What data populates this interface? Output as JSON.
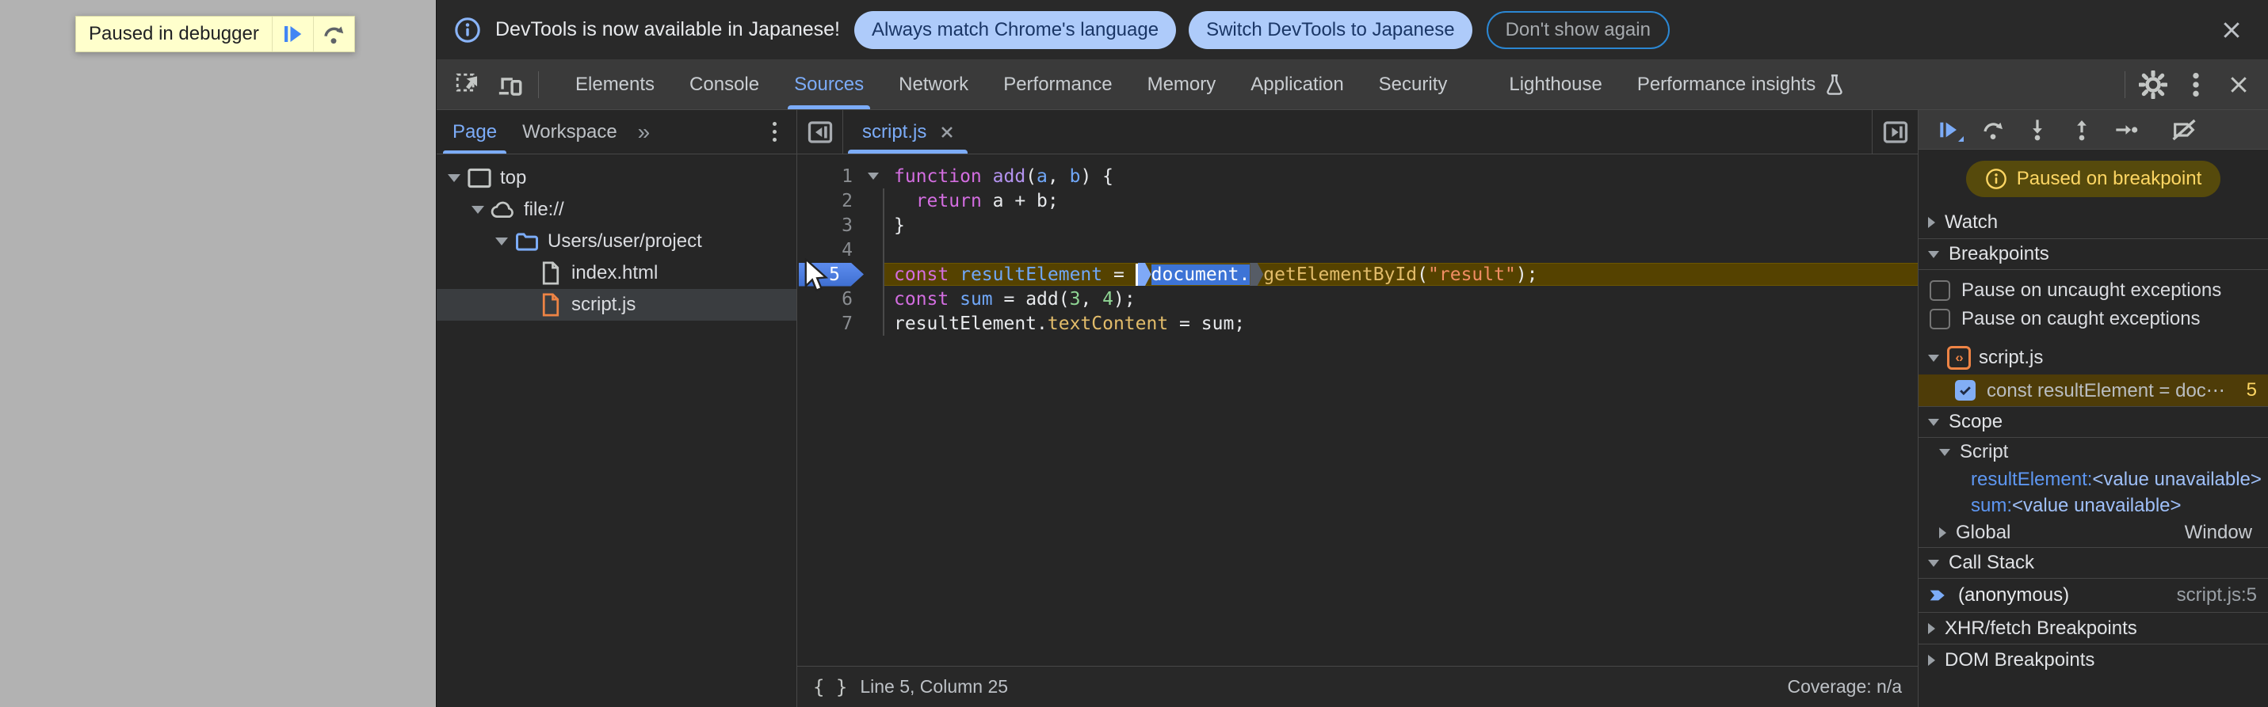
{
  "page_overlay": {
    "paused_label": "Paused in debugger"
  },
  "infobar": {
    "message": "DevTools is now available in Japanese!",
    "actions": [
      "Always match Chrome's language",
      "Switch DevTools to Japanese"
    ],
    "dismiss_label": "Don't show again"
  },
  "toolbar": {
    "tabs": [
      "Elements",
      "Console",
      "Sources",
      "Network",
      "Performance",
      "Memory",
      "Application",
      "Security",
      "Lighthouse",
      "Performance insights"
    ],
    "selected_tab": "Sources",
    "experimental_tab": "Performance insights"
  },
  "navigator": {
    "tabs": [
      "Page",
      "Workspace"
    ],
    "selected_tab": "Page",
    "more_tabs_symbol": "»",
    "tree": [
      {
        "label": "top",
        "icon": "frame-icon",
        "depth": 0,
        "expanded": true
      },
      {
        "label": "file://",
        "icon": "cloud-icon",
        "depth": 1,
        "expanded": true
      },
      {
        "label": "Users/user/project",
        "icon": "folder-icon",
        "depth": 2,
        "expanded": true
      },
      {
        "label": "index.html",
        "icon": "file-html-icon",
        "depth": 3,
        "selected": false
      },
      {
        "label": "script.js",
        "icon": "file-js-icon",
        "depth": 3,
        "selected": true
      }
    ]
  },
  "editor": {
    "open_tab": "script.js",
    "lines": [
      {
        "num": 1,
        "fold": true,
        "tokens": [
          {
            "t": "function",
            "c": "kw"
          },
          {
            "t": " "
          },
          {
            "t": "add",
            "c": "fn"
          },
          {
            "t": "("
          },
          {
            "t": "a",
            "c": "vr"
          },
          {
            "t": ", "
          },
          {
            "t": "b",
            "c": "vr"
          },
          {
            "t": ") {"
          }
        ]
      },
      {
        "num": 2,
        "tokens": [
          {
            "t": "  "
          },
          {
            "t": "return",
            "c": "kw"
          },
          {
            "t": " a + b;"
          }
        ]
      },
      {
        "num": 3,
        "tokens": [
          {
            "t": "}"
          }
        ]
      },
      {
        "num": 4,
        "tokens": []
      },
      {
        "num": 5,
        "current": true,
        "tokens": [
          {
            "t": "const",
            "c": "kw"
          },
          {
            "t": " "
          },
          {
            "t": "resultElement",
            "c": "vr"
          },
          {
            "t": " = "
          },
          {
            "m": "caret"
          },
          {
            "m": "bp-active"
          },
          {
            "t": "document.",
            "c": "sel"
          },
          {
            "m": "bp-dim"
          },
          {
            "t": "getElementById",
            "c": "prop"
          },
          {
            "t": "("
          },
          {
            "t": "\"result\"",
            "c": "str"
          },
          {
            "t": ");"
          }
        ]
      },
      {
        "num": 6,
        "tokens": [
          {
            "t": "const",
            "c": "kw"
          },
          {
            "t": " "
          },
          {
            "t": "sum",
            "c": "vr"
          },
          {
            "t": " = add("
          },
          {
            "t": "3",
            "c": "num"
          },
          {
            "t": ", "
          },
          {
            "t": "4",
            "c": "num"
          },
          {
            "t": ");"
          }
        ]
      },
      {
        "num": 7,
        "tokens": [
          {
            "t": "resultElement."
          },
          {
            "t": "textContent",
            "c": "prop"
          },
          {
            "t": " = sum;"
          }
        ]
      }
    ],
    "status": {
      "format_icon": "{ }",
      "position": "Line 5, Column 25",
      "coverage": "Coverage: n/a"
    }
  },
  "debugger_sidebar": {
    "paused_message": "Paused on breakpoint",
    "watch": {
      "title": "Watch",
      "expanded": false
    },
    "breakpoints": {
      "title": "Breakpoints",
      "expanded": true,
      "toggles": [
        {
          "label": "Pause on uncaught exceptions",
          "checked": false
        },
        {
          "label": "Pause on caught exceptions",
          "checked": false
        }
      ],
      "files": [
        {
          "name": "script.js",
          "items": [
            {
              "label": "const resultElement = doc⋯",
              "checked": true,
              "line": "5"
            }
          ]
        }
      ]
    },
    "scope": {
      "title": "Scope",
      "sections": [
        {
          "name": "Script",
          "expanded": true,
          "vars": [
            {
              "name": "resultElement",
              "value": "<value unavailable>"
            },
            {
              "name": "sum",
              "value": "<value unavailable>"
            }
          ]
        },
        {
          "name": "Global",
          "expanded": false,
          "value": "Window"
        }
      ]
    },
    "call_stack": {
      "title": "Call Stack",
      "frames": [
        {
          "name": "(anonymous)",
          "location": "script.js:5"
        }
      ]
    },
    "xhr_breakpoints": {
      "title": "XHR/fetch Breakpoints",
      "expanded": false
    },
    "dom_breakpoints": {
      "title": "DOM Breakpoints",
      "expanded": false
    }
  },
  "colors": {
    "accent_blue": "#7cacf8",
    "paused_yellow": "#fdd663",
    "exec_line_bg": "#554200",
    "selection_blue": "#3d74d6",
    "banner_bg": "#ffffcc",
    "file_js_orange": "#ee8445"
  },
  "icons": {
    "list": [
      "info-icon",
      "close-icon",
      "inspect-icon",
      "device-toolbar-icon",
      "gear-icon",
      "kebab-menu-icon",
      "flask-icon",
      "frame-icon",
      "cloud-icon",
      "folder-icon",
      "file-html-icon",
      "file-js-icon",
      "panel-left-icon",
      "panel-right-icon",
      "resume-icon",
      "step-over-icon",
      "step-into-icon",
      "step-out-icon",
      "step-icon",
      "deactivate-breakpoints-icon",
      "curly-braces-icon",
      "call-stack-arrow-icon",
      "mouse-cursor"
    ]
  }
}
